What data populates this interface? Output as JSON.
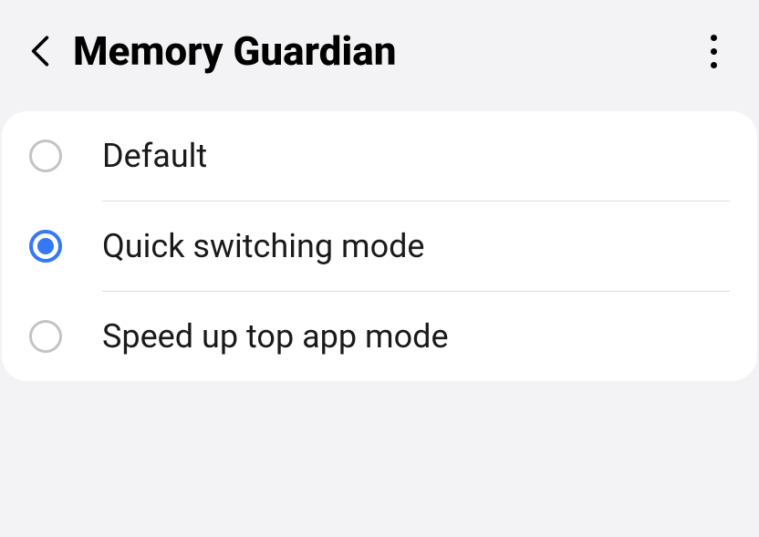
{
  "header": {
    "title": "Memory Guardian"
  },
  "options": [
    {
      "label": "Default",
      "selected": false
    },
    {
      "label": "Quick switching mode",
      "selected": true
    },
    {
      "label": "Speed up top app mode",
      "selected": false
    }
  ]
}
